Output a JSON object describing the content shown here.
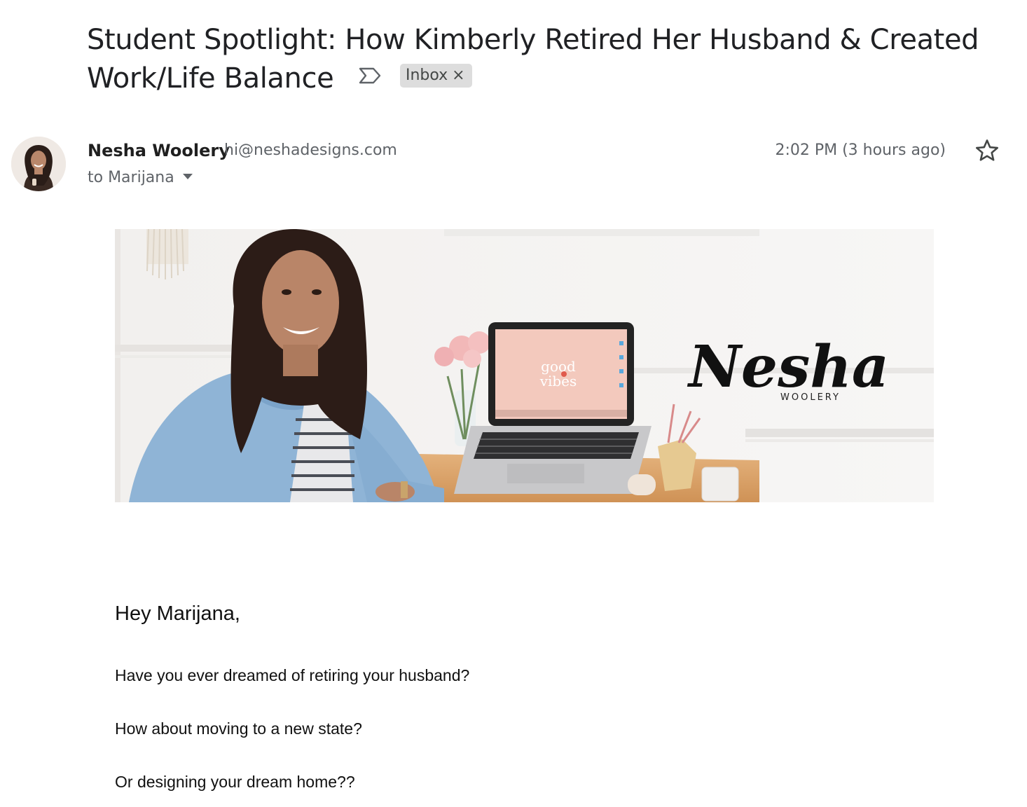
{
  "email": {
    "subject": "Student Spotlight: How Kimberly Retired Her Husband & Created Work/Life Balance",
    "label": "Inbox",
    "label_close": "×",
    "important_icon": "important-marker-icon",
    "star_icon": "star-outline-icon",
    "sender": {
      "name": "Nesha Woolery",
      "email": "hi@neshadesigns.com"
    },
    "recipient_line": "to Marijana",
    "timestamp": "2:02 PM (3 hours ago)"
  },
  "banner": {
    "logo_script": "Nesha",
    "logo_sub": "WOOLERY",
    "laptop_screen_text_1": "good",
    "laptop_screen_text_2": "vibes"
  },
  "message": {
    "greeting": "Hey Marijana,",
    "paragraphs": [
      "Have you ever dreamed of retiring your husband?",
      "How about moving to a new state?",
      "Or designing your dream home??"
    ]
  },
  "colors": {
    "text_primary": "#202124",
    "text_secondary": "#5f6368",
    "chip_bg": "#dddddd"
  }
}
